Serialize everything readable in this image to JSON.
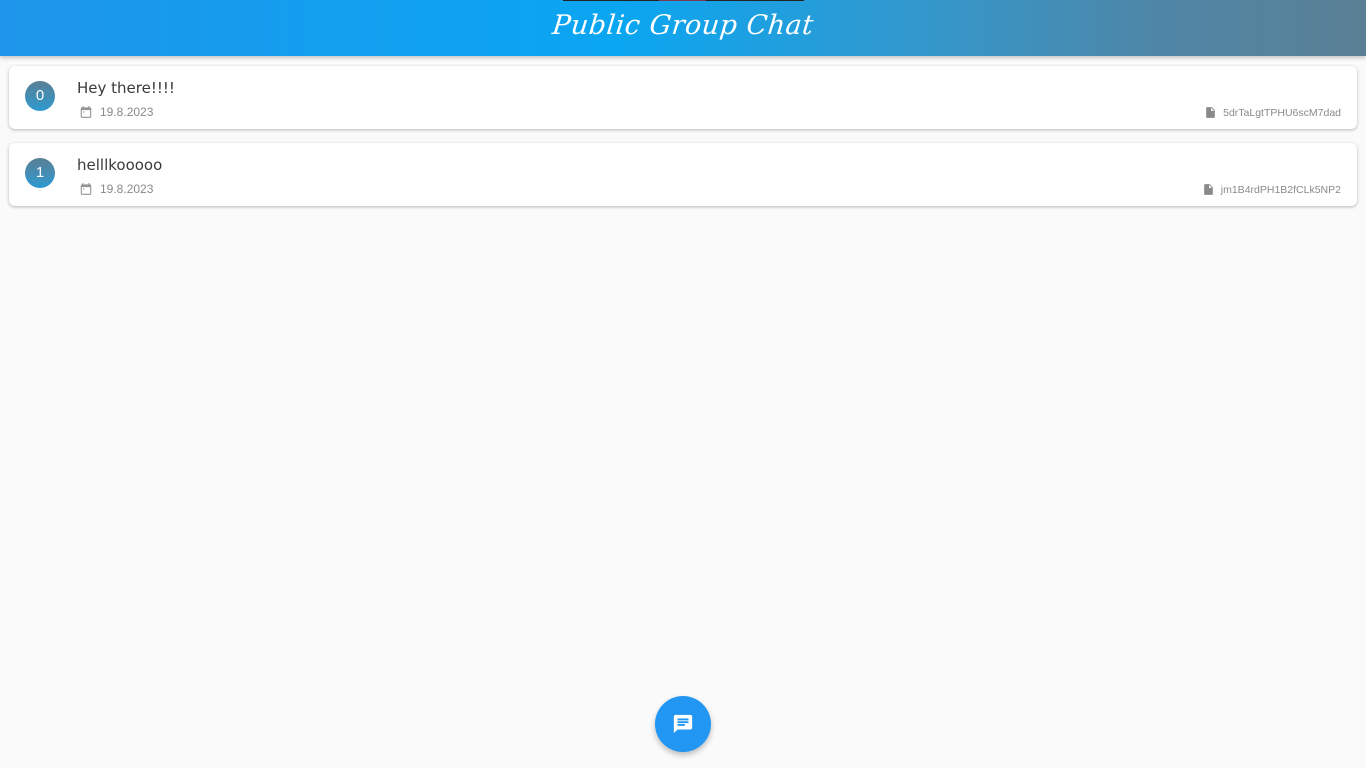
{
  "header": {
    "title": "Public Group Chat"
  },
  "messages": [
    {
      "index": "0",
      "text": "Hey there!!!!",
      "date": "19.8.2023",
      "doc_id": "5drTaLgtTPHU6scM7dad",
      "date_icon": "calendar-icon",
      "doc_icon": "document-icon"
    },
    {
      "index": "1",
      "text": "helllkooooo",
      "date": "19.8.2023",
      "doc_id": "jm1B4rdPH1B2fCLk5NP2",
      "date_icon": "calendar-icon",
      "doc_icon": "document-icon"
    }
  ],
  "fab": {
    "icon": "chat-message-icon"
  },
  "colors": {
    "accent": "#2196f3",
    "header_gradient_start": "#1e95ea",
    "header_gradient_end": "#5a7f94",
    "background": "#fafafa"
  }
}
